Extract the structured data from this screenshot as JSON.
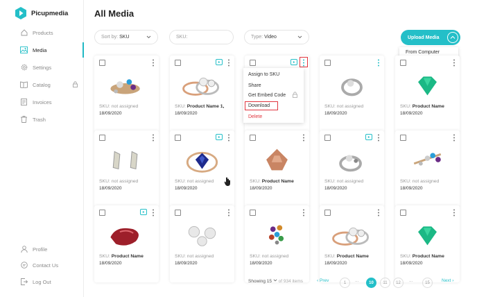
{
  "app": {
    "name": "Picupmedia",
    "accent": "#24bfc8"
  },
  "sidebar": {
    "items": [
      {
        "label": "Products",
        "icon": "home-icon"
      },
      {
        "label": "Media",
        "icon": "image-icon"
      },
      {
        "label": "Settings",
        "icon": "gear-icon"
      },
      {
        "label": "Catalog",
        "icon": "catalog-icon"
      },
      {
        "label": "Invoices",
        "icon": "invoice-icon"
      },
      {
        "label": "Trash",
        "icon": "trash-icon"
      }
    ],
    "bottom": [
      {
        "label": "Profile",
        "icon": "user-icon"
      },
      {
        "label": "Contact Us",
        "icon": "chat-icon"
      },
      {
        "label": "Log Out",
        "icon": "logout-icon"
      }
    ]
  },
  "main": {
    "title": "All Media",
    "sort": {
      "prefix": "Sort by:",
      "value": "SKU"
    },
    "sku_filter": {
      "placeholder": "SKU:"
    },
    "type": {
      "prefix": "Type:",
      "value": "Video"
    },
    "upload": {
      "label": "Upload Media",
      "menu": "From Computer"
    }
  },
  "context_menu": [
    "Assign to SKU",
    "Share",
    "Get Embed Code",
    "Download",
    "Delete"
  ],
  "cards": [
    {
      "sku_label": "SKU:",
      "sku_value": "not assigned",
      "assigned": false,
      "date": "18/09/2020",
      "video": false
    },
    {
      "sku_label": "SKU:",
      "sku_value": "Product Name 1,",
      "assigned": true,
      "date": "18/09/2020",
      "video": true
    },
    {
      "sku_label": "",
      "sku_value": "",
      "assigned": false,
      "date": "",
      "video": true
    },
    {
      "sku_label": "SKU:",
      "sku_value": "not assigned",
      "assigned": false,
      "date": "18/09/2020",
      "video": false
    },
    {
      "sku_label": "SKU:",
      "sku_value": "Product Name",
      "assigned": true,
      "date": "18/09/2020",
      "video": false
    },
    {
      "sku_label": "SKU:",
      "sku_value": "not assigned",
      "assigned": false,
      "date": "18/09/2020",
      "video": false
    },
    {
      "sku_label": "SKU:",
      "sku_value": "not assigned",
      "assigned": false,
      "date": "18/09/2020",
      "video": true
    },
    {
      "sku_label": "SKU:",
      "sku_value": "Product Name",
      "assigned": true,
      "date": "18/09/2020",
      "video": false
    },
    {
      "sku_label": "SKU:",
      "sku_value": "not assigned",
      "assigned": false,
      "date": "18/09/2020",
      "video": true
    },
    {
      "sku_label": "SKU:",
      "sku_value": "not assigned",
      "assigned": false,
      "date": "18/09/2020",
      "video": false
    },
    {
      "sku_label": "SKU:",
      "sku_value": "Product Name",
      "assigned": true,
      "date": "18/09/2020",
      "video": true
    },
    {
      "sku_label": "SKU:",
      "sku_value": "not assigned",
      "assigned": false,
      "date": "18/09/2020",
      "video": false
    },
    {
      "sku_label": "SKU:",
      "sku_value": "not assigned",
      "assigned": false,
      "date": "18/09/2020",
      "video": false
    },
    {
      "sku_label": "SKU:",
      "sku_value": "Product Name",
      "assigned": true,
      "date": "18/09/2020",
      "video": false
    },
    {
      "sku_label": "SKU:",
      "sku_value": "Product Name",
      "assigned": true,
      "date": "18/09/2020",
      "video": false
    }
  ],
  "pagination": {
    "showing": "Showing 15",
    "of_items": "of 934 items",
    "prev": "Prev",
    "next": "Next",
    "pages": [
      "1",
      "...",
      "10",
      "11",
      "12",
      "...",
      "15"
    ],
    "current": "10"
  }
}
